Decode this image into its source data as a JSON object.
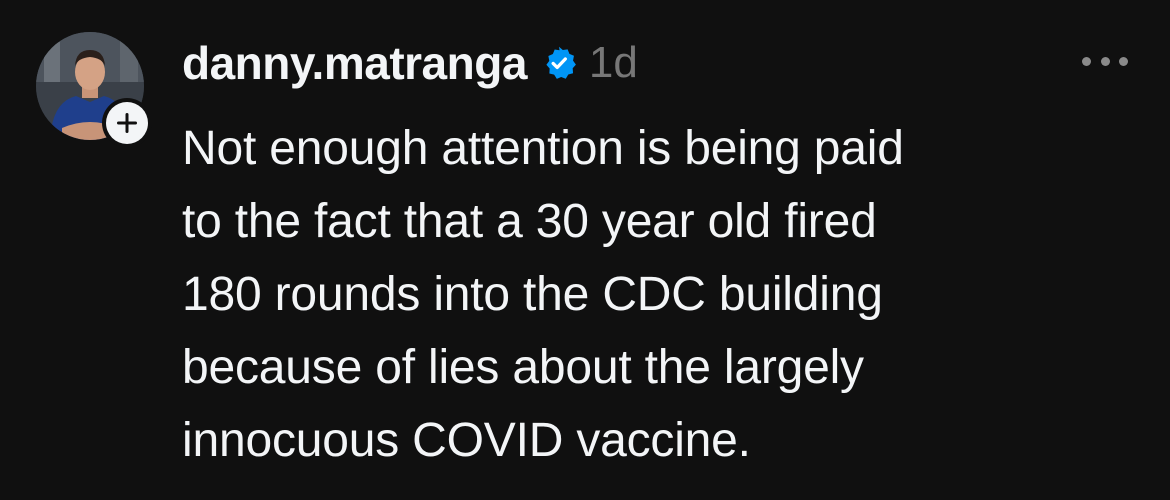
{
  "post": {
    "author": {
      "username": "danny.matranga",
      "verified": true,
      "avatar_icon": "profile-photo"
    },
    "timestamp": "1d",
    "follow_icon": "plus-icon",
    "more_icon": "ellipsis-icon",
    "text_lines": [
      "Not enough attention is being paid",
      "to the fact that a 30 year old fired",
      "180 rounds into the CDC building",
      "because of lies about the largely",
      "innocuous COVID vaccine."
    ]
  },
  "colors": {
    "background": "#101010",
    "text": "#f3f5f7",
    "muted": "#777777",
    "verified_badge": "#0095f6"
  }
}
